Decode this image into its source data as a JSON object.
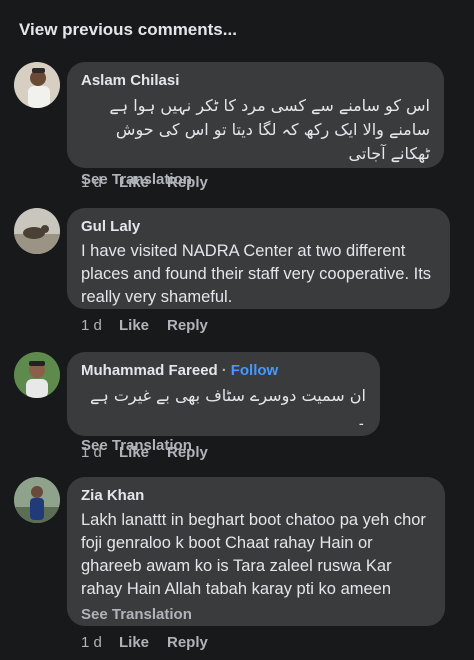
{
  "view_previous": "View previous comments...",
  "comments": [
    {
      "author": "Aslam Chilasi",
      "text": "اس کو سامنے سے کسی مرد کا ٹکر نہیں ہوا ہے سامنے والا ایک رکھ کہ لگا دیتا تو اس کی حوش ٹھکانے آجاتی",
      "see_translation": "See Translation",
      "time": "1 d",
      "like": "Like",
      "reply": "Reply"
    },
    {
      "author": "Gul Laly",
      "text": "I have visited NADRA Center at two different places and found their staff very cooperative. Its really very shameful.",
      "time": "1 d",
      "like": "Like",
      "reply": "Reply"
    },
    {
      "author": "Muhammad Fareed",
      "separator": "·",
      "follow": "Follow",
      "text": "ان سمیت دوسرے سٹاف بھی بے غیرت ہے ۔",
      "see_translation": "See Translation",
      "time": "1 d",
      "like": "Like",
      "reply": "Reply"
    },
    {
      "author": "Zia Khan",
      "text": "Lakh lanattt in beghart boot chatoo pa yeh chor foji genraloo k boot Chaat rahay Hain or ghareeb awam ko is Tara zaleel ruswa Kar rahay Hain Allah tabah karay pti ko ameen",
      "see_translation": "See Translation",
      "time": "1 d",
      "like": "Like",
      "reply": "Reply"
    }
  ],
  "colors": {
    "background": "#18191a",
    "bubble": "#3a3b3c",
    "text": "#e4e6eb",
    "secondary": "#b0b3b8",
    "follow": "#4599ff"
  },
  "icons": [
    "avatar-aslam-chilasi",
    "avatar-gul-laly",
    "avatar-muhammad-fareed",
    "avatar-zia-khan"
  ]
}
